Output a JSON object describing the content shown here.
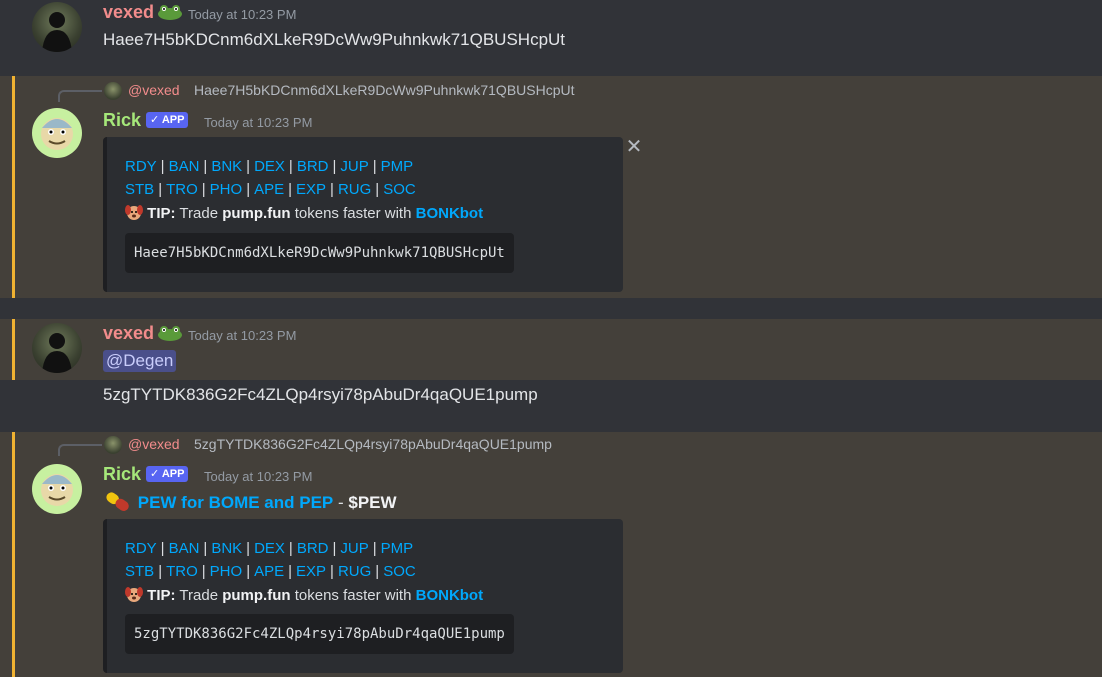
{
  "messages": {
    "m1": {
      "author": "vexed",
      "timestamp": "Today at 10:23 PM",
      "content": "Haee7H5bKDCnm6dXLkeR9DcWw9Puhnkwk71QBUSHcpUt"
    },
    "m2": {
      "reply_author": "@vexed",
      "reply_text": "Haee7H5bKDCnm6dXLkeR9DcWw9Puhnkwk71QBUSHcpUt",
      "author": "Rick",
      "badge": "✓ APP",
      "timestamp": "Today at 10:23 PM",
      "embed": {
        "row1": [
          "RDY",
          "BAN",
          "BNK",
          "DEX",
          "BRD",
          "JUP",
          "PMP"
        ],
        "row2": [
          "STB",
          "TRO",
          "PHO",
          "APE",
          "EXP",
          "RUG",
          "SOC"
        ],
        "tip_label": "TIP:",
        "tip_pre": " Trade ",
        "tip_token": "pump.fun",
        "tip_mid": " tokens faster with ",
        "tip_bot": "BONKbot",
        "code": "Haee7H5bKDCnm6dXLkeR9DcWw9Puhnkwk71QBUSHcpUt"
      },
      "close": "✕"
    },
    "m3": {
      "author": "vexed",
      "timestamp": "Today at 10:23 PM",
      "mention": "@Degen",
      "content": "5zgTYTDK836G2Fc4ZLQp4rsyi78pAbuDr4qaQUE1pump"
    },
    "m4": {
      "reply_author": "@vexed",
      "reply_text": "5zgTYTDK836G2Fc4ZLQp4rsyi78pAbuDr4qaQUE1pump",
      "author": "Rick",
      "badge": "✓ APP",
      "timestamp": "Today at 10:23 PM",
      "title_link": "PEW for BOME and PEP",
      "title_dash": " - ",
      "title_ticker": "$PEW",
      "embed": {
        "row1": [
          "RDY",
          "BAN",
          "BNK",
          "DEX",
          "BRD",
          "JUP",
          "PMP"
        ],
        "row2": [
          "STB",
          "TRO",
          "PHO",
          "APE",
          "EXP",
          "RUG",
          "SOC"
        ],
        "tip_label": "TIP:",
        "tip_pre": " Trade ",
        "tip_token": "pump.fun",
        "tip_mid": " tokens faster with ",
        "tip_bot": "BONKbot",
        "code": "5zgTYTDK836G2Fc4ZLQp4rsyi78pAbuDr4qaQUE1pump"
      }
    }
  },
  "icons": {
    "frog": "frog-emoji-icon",
    "dog": "dog-emoji-icon",
    "pill": "pill-emoji-icon",
    "close": "close-icon"
  },
  "colors": {
    "background": "#313338",
    "mention_highlight": "#44403a",
    "mention_bar": "#f0b232",
    "link": "#00a8fc",
    "vexed_name": "#f28c8c",
    "rick_name": "#a6e87a",
    "app_badge": "#5865f2"
  }
}
